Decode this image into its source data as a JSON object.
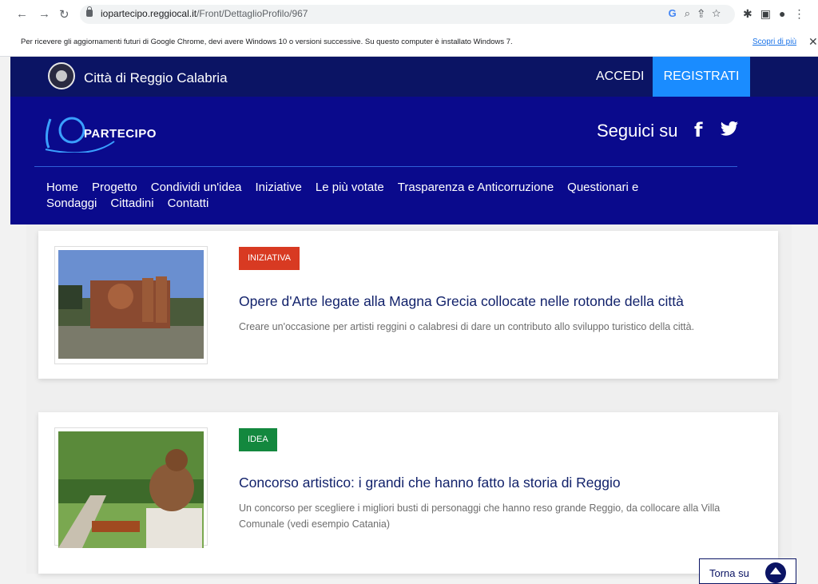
{
  "browser": {
    "url_host": "iopartecipo.reggiocal.it",
    "url_path": "/Front/DettaglioProfilo/967",
    "info_text": "Per ricevere gli aggiornamenti futuri di Google Chrome, devi avere Windows 10 o versioni successive. Su questo computer è installato Windows 7.",
    "info_link": "Scopri di più",
    "icons": [
      "back-icon",
      "forward-icon",
      "reload-icon",
      "lock-icon",
      "google-icon",
      "zoom-icon",
      "share-icon",
      "star-icon",
      "extensions-icon",
      "sidepanel-icon",
      "profile-icon",
      "menu-icon",
      "close-icon"
    ]
  },
  "header": {
    "city_name": "Città di Reggio Calabria",
    "login_label": "ACCEDI",
    "register_label": "REGISTRATI",
    "brand_text": "PARTECIPO",
    "follow_label": "Seguici su"
  },
  "menu": [
    "Home",
    "Progetto",
    "Condividi un'idea",
    "Iniziative",
    "Le più votate",
    "Trasparenza e Anticorruzione",
    "Questionari e Sondaggi",
    "Cittadini",
    "Contatti"
  ],
  "cards": [
    {
      "badge": "INIZIATIVA",
      "badge_color": "#d83a22",
      "title": "Opere d'Arte legate alla Magna Grecia collocate nelle rotonde della città",
      "description": "Creare un'occasione per artisti reggini o calabresi di dare un contributo allo sviluppo turistico della città."
    },
    {
      "badge": "IDEA",
      "badge_color": "#13883e",
      "title": "Concorso artistico: i grandi che hanno fatto la storia di Reggio",
      "description": "Un concorso per scegliere i migliori busti di personaggi che hanno reso grande Reggio, da collocare alla Villa Comunale (vedi esempio Catania)"
    }
  ],
  "back_to_top": "Torna su",
  "colors": {
    "topbar": "#0b1464",
    "brandbar": "#0a0a8c",
    "register": "#1a8cff",
    "title": "#12226b"
  }
}
